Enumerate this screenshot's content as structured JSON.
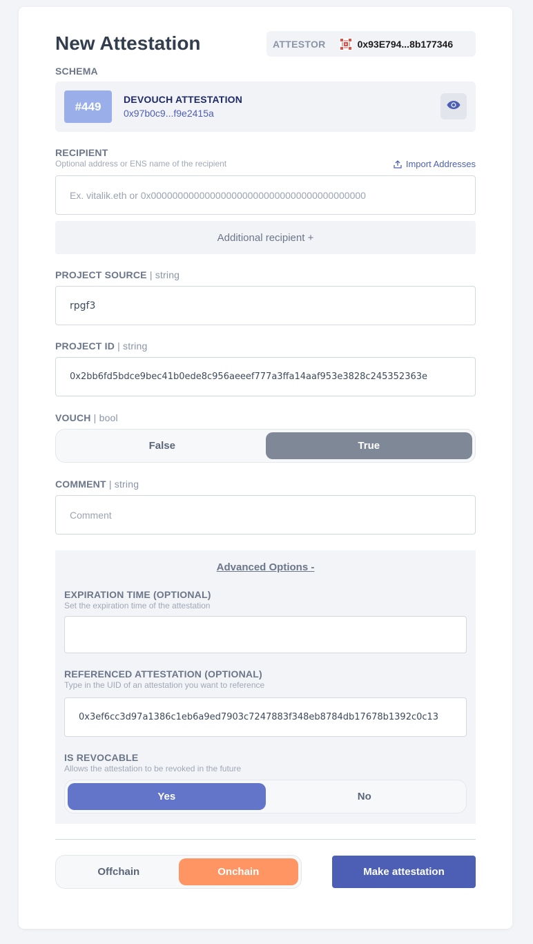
{
  "header": {
    "title": "New Attestation",
    "attestor_label": "ATTESTOR",
    "attestor_address": "0x93E794...8b177346"
  },
  "schema": {
    "label": "SCHEMA",
    "number": "#449",
    "name": "DEVOUCH ATTESTATION",
    "uid": "0x97b0c9...f9e2415a"
  },
  "recipient": {
    "label": "RECIPIENT",
    "sublabel": "Optional address or ENS name of the recipient",
    "import_label": "Import Addresses",
    "placeholder": "Ex. vitalik.eth or 0x0000000000000000000000000000000000000000",
    "additional_label": "Additional recipient +"
  },
  "fields": {
    "project_source": {
      "label": "PROJECT SOURCE",
      "type": "| string",
      "value": "rpgf3"
    },
    "project_id": {
      "label": "PROJECT ID",
      "type": "| string",
      "value": "0x2bb6fd5bdce9bec41b0ede8c956aeeef777a3ffa14aaf953e3828c245352363e"
    },
    "vouch": {
      "label": "VOUCH",
      "type": "| bool",
      "options": [
        "False",
        "True"
      ],
      "selected": "True"
    },
    "comment": {
      "label": "COMMENT",
      "type": "| string",
      "placeholder": "Comment"
    }
  },
  "advanced": {
    "toggle_label": "Advanced Options -",
    "expiration": {
      "label": "EXPIRATION TIME (OPTIONAL)",
      "sublabel": "Set the expiration time of the attestation",
      "value": ""
    },
    "referenced": {
      "label": "REFERENCED ATTESTATION (OPTIONAL)",
      "sublabel": "Type in the UID of an attestation you want to reference",
      "value": "0x3ef6cc3d97a1386c1eb6a9ed7903c7247883f348eb8784db17678b1392c0c13"
    },
    "revocable": {
      "label": "IS REVOCABLE",
      "sublabel": "Allows the attestation to be revoked in the future",
      "options": [
        "Yes",
        "No"
      ],
      "selected": "Yes"
    }
  },
  "footer": {
    "chain_options": [
      "Offchain",
      "Onchain"
    ],
    "chain_selected": "Onchain",
    "make_label": "Make attestation"
  },
  "colors": {
    "primary": "#4c5fb5",
    "schema_badge": "#9aaeea",
    "vouch_selected": "#7f8896",
    "revocable_selected": "#6275c9",
    "onchain_selected": "#ff9562"
  },
  "icons": {
    "attestor": "identicon",
    "schema_view": "eye-icon",
    "import": "upload-icon"
  }
}
